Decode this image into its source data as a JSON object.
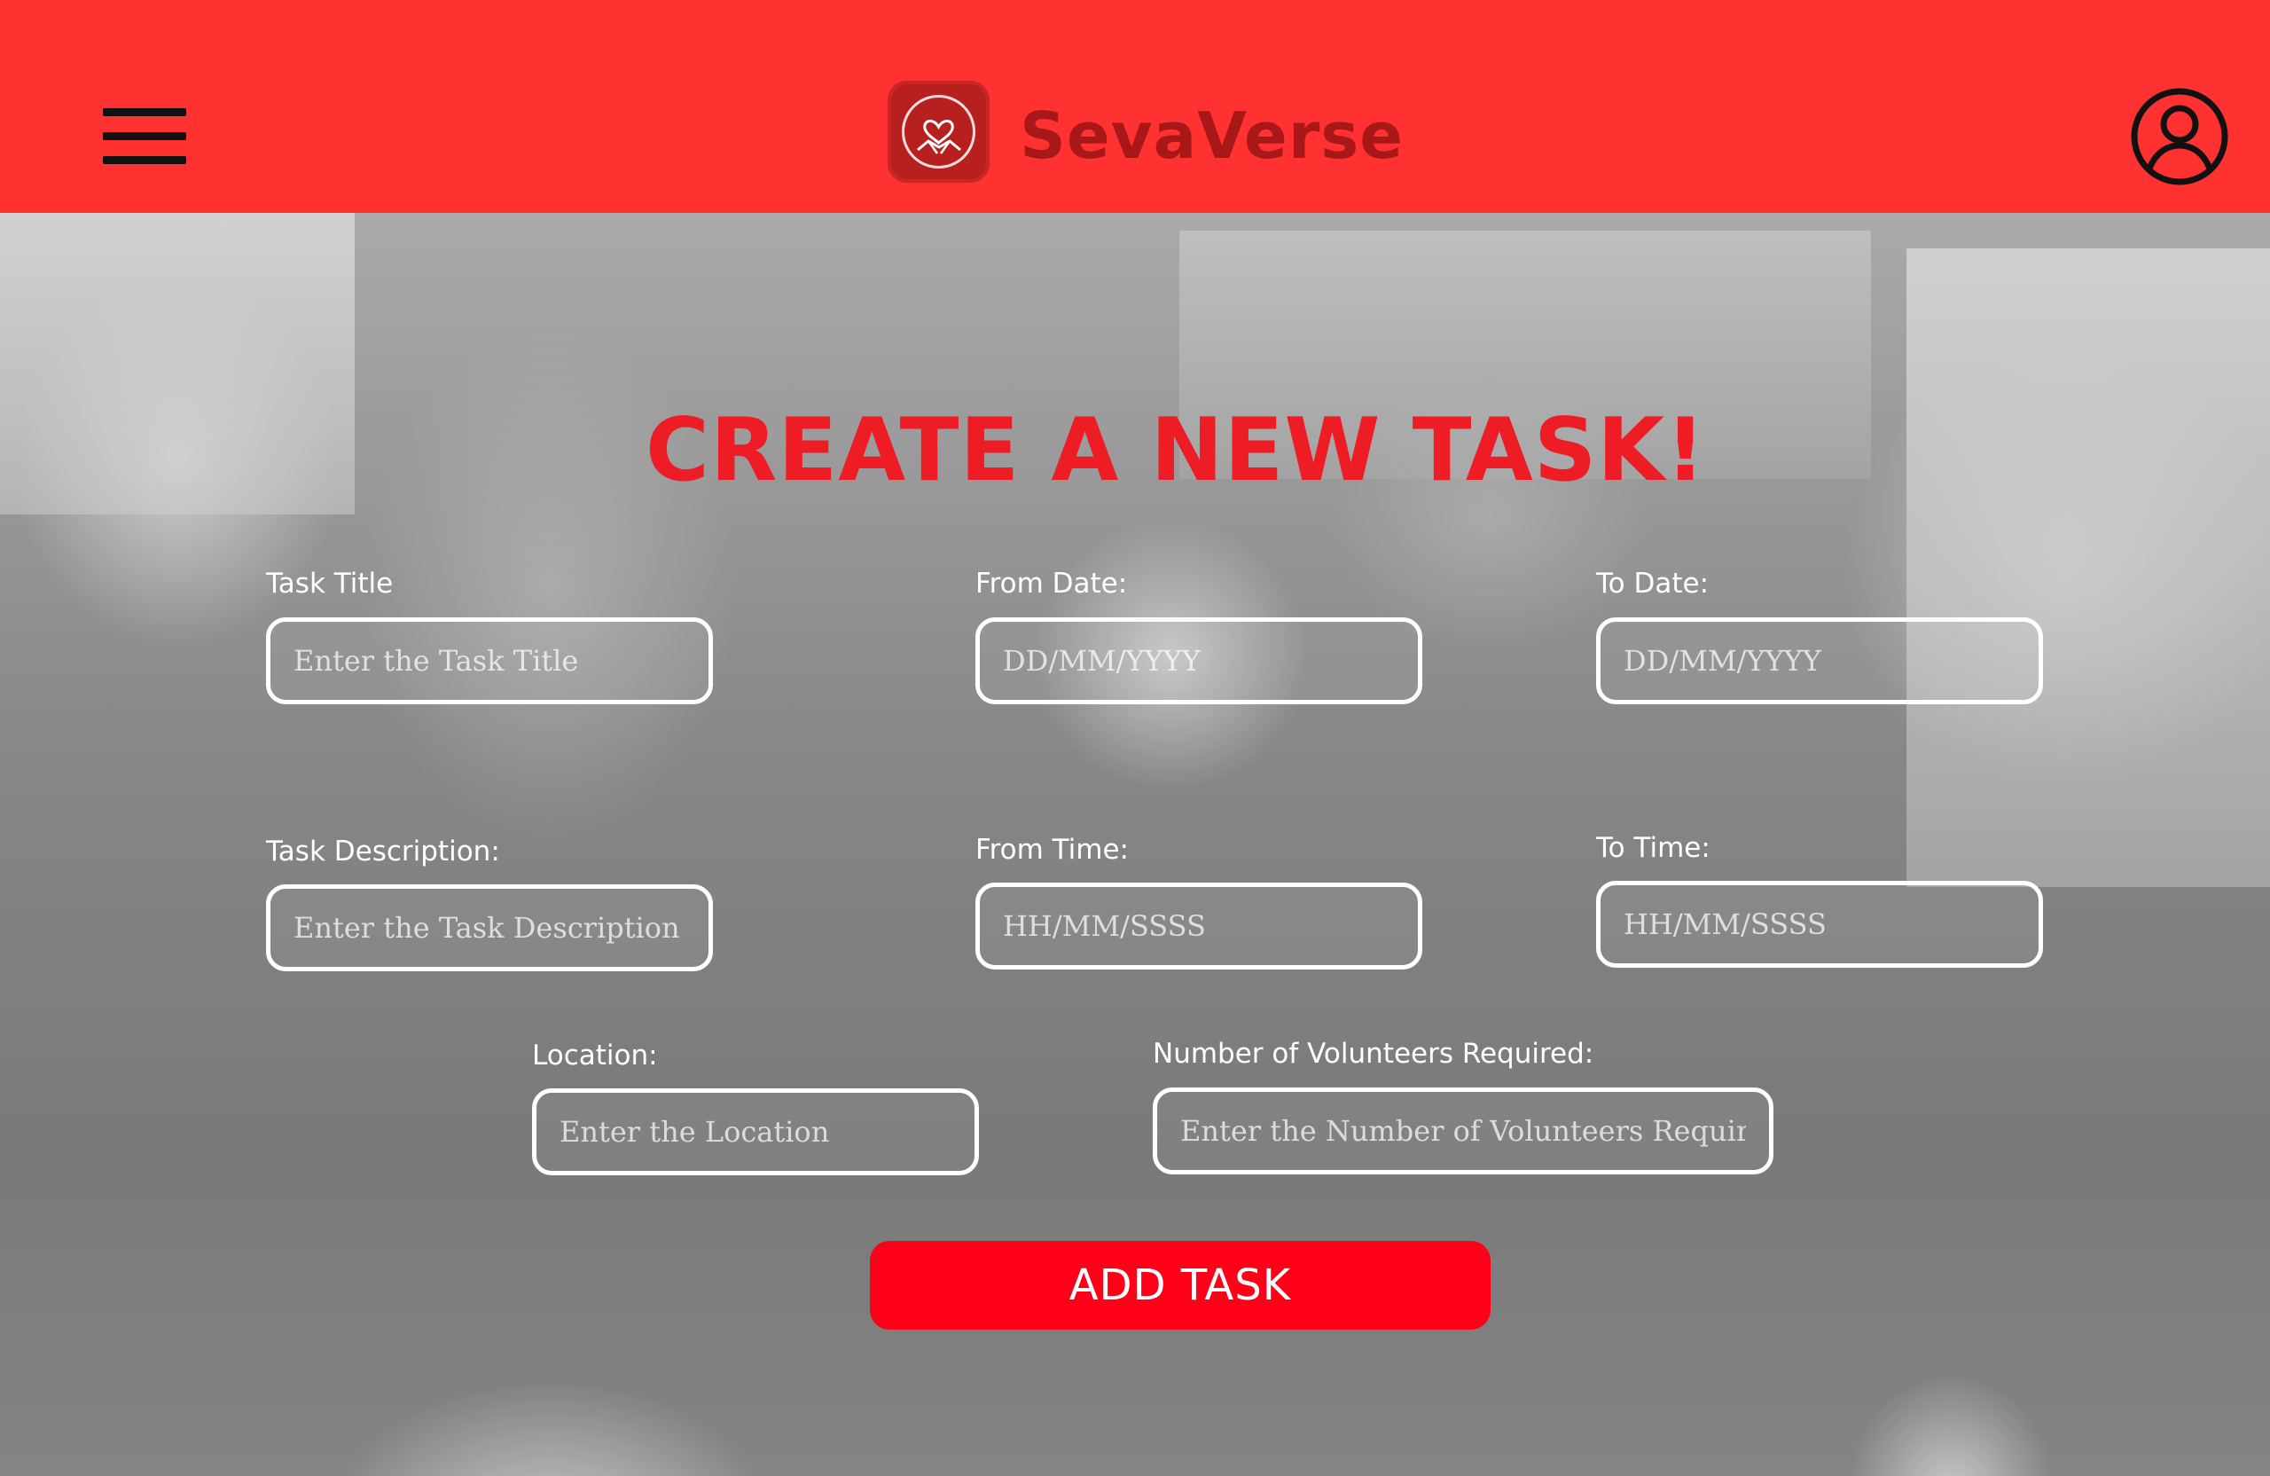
{
  "header": {
    "brand_name": "SevaVerse",
    "menu_icon": "hamburger-menu-icon",
    "logo_icon": "heart-handshake-logo-icon",
    "profile_icon": "user-circle-icon"
  },
  "form": {
    "title": "CREATE A NEW TASK!",
    "task_title": {
      "label": "Task Title",
      "placeholder": "Enter the Task Title",
      "value": ""
    },
    "from_date": {
      "label": "From Date:",
      "placeholder": "DD/MM/YYYY",
      "value": ""
    },
    "to_date": {
      "label": "To Date:",
      "placeholder": "DD/MM/YYYY",
      "value": ""
    },
    "task_description": {
      "label": "Task Description:",
      "placeholder": "Enter the Task Description",
      "value": ""
    },
    "from_time": {
      "label": "From Time:",
      "placeholder": "HH/MM/SSSS",
      "value": ""
    },
    "to_time": {
      "label": "To Time:",
      "placeholder": "HH/MM/SSSS",
      "value": ""
    },
    "location": {
      "label": "Location:",
      "placeholder": "Enter the Location",
      "value": ""
    },
    "volunteers": {
      "label": "Number of Volunteers Required:",
      "placeholder": "Enter the Number of Volunteers Required",
      "value": ""
    },
    "submit_label": "ADD TASK"
  },
  "colors": {
    "header_bg": "#ff3131",
    "title_red": "#ee1c24",
    "button_red": "#ff0019",
    "brand_dark_red": "#a81818"
  }
}
